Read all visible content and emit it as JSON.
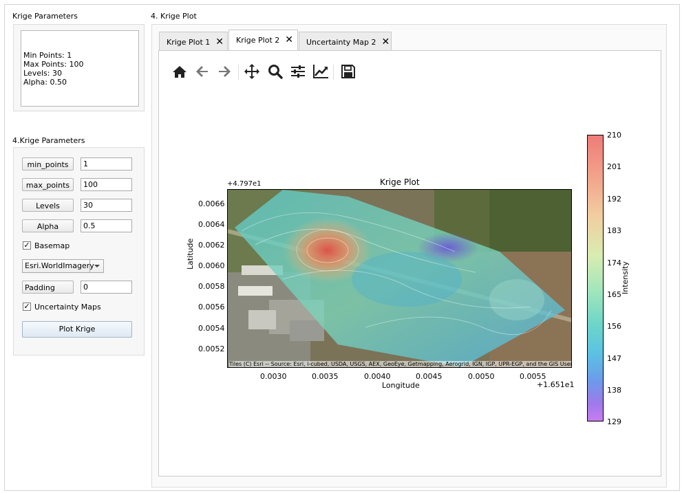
{
  "left": {
    "summary_title": "Krige Parameters",
    "summary_lines": [
      "Min Points: 1",
      "Max Points: 100",
      "Levels: 30",
      "Alpha: 0.50"
    ],
    "params_title": "4.Krige Parameters",
    "min_points_label": "min_points",
    "min_points_value": "1",
    "max_points_label": "max_points",
    "max_points_value": "100",
    "levels_label": "Levels",
    "levels_value": "30",
    "alpha_label": "Alpha",
    "alpha_value": "0.5",
    "basemap_label": "Basemap",
    "basemap_checked": "✓",
    "basemap_select": "Esri.WorldImagery",
    "padding_label": "Padding",
    "padding_value": "0",
    "uncertainty_label": "Uncertainty Maps",
    "uncertainty_checked": "✓",
    "plot_button": "Plot Krige"
  },
  "right": {
    "section_title": "4. Krige Plot",
    "tabs": [
      {
        "label": "Krige Plot 1",
        "close": "✕"
      },
      {
        "label": "Krige Plot 2",
        "close": "✕"
      },
      {
        "label": "Uncertainty Map 2",
        "close": "✕"
      }
    ],
    "active_tab": 1,
    "toolbar_icons": [
      "home-icon",
      "back-arrow-icon",
      "forward-arrow-icon",
      "pan-icon",
      "zoom-icon",
      "configure-subplots-icon",
      "edit-axis-icon",
      "save-icon"
    ]
  },
  "plot": {
    "title": "Krige Plot",
    "xlabel": "Longitude",
    "ylabel": "Latitude",
    "y_offset": "+4.797e1",
    "x_offset": "+1.651e1",
    "yticks": [
      "0.0066",
      "0.0064",
      "0.0062",
      "0.0060",
      "0.0058",
      "0.0056",
      "0.0054",
      "0.0052"
    ],
    "xticks": [
      "0.0030",
      "0.0035",
      "0.0040",
      "0.0045",
      "0.0050",
      "0.0055"
    ],
    "attribution": "Tiles (C) Esri -- Source: Esri, i-cubed, USDA, USGS, AEX, GeoEye, Getmapping, Aerogrid, IGN, IGP, UPR-EGP, and the GIS User Community",
    "colorbar_label": "Intensity",
    "colorbar_ticks": [
      "210",
      "201",
      "192",
      "183",
      "174",
      "165",
      "156",
      "147",
      "138",
      "129"
    ]
  }
}
